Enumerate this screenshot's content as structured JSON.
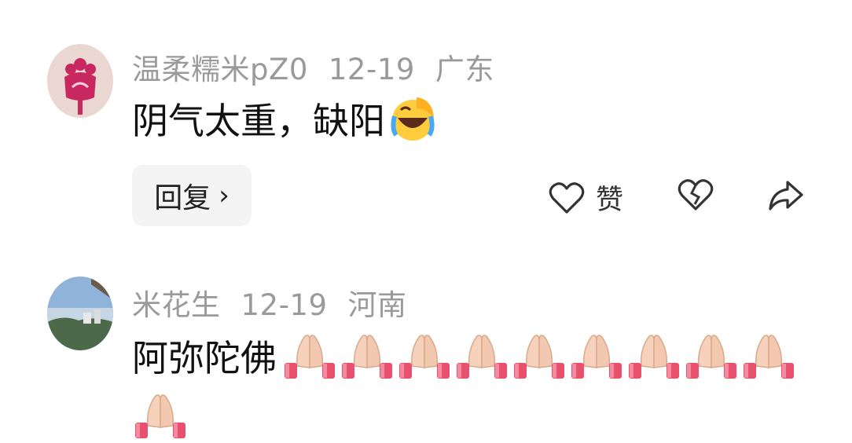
{
  "comments": [
    {
      "username": "温柔糯米pZ0",
      "date": "12-19",
      "location": "广东",
      "text": "阴气太重，缺阳",
      "emoji": "laughing-crying-emoji",
      "reply_label": "回复",
      "reply_chevron": "›",
      "like_label": "赞"
    },
    {
      "username": "米花生",
      "date": "12-19",
      "location": "河南",
      "text": "阿弥陀佛",
      "emoji": "praying-hands-emoji",
      "emoji_count": 10
    }
  ],
  "icons": [
    "heart-icon",
    "broken-heart-icon",
    "share-icon"
  ],
  "colors": {
    "meta_text": "#9a9a9a",
    "body_text": "#111111",
    "reply_bg": "#f4f4f4",
    "avatar1": "#c8285f",
    "pray_cuff": "#e8506e"
  }
}
